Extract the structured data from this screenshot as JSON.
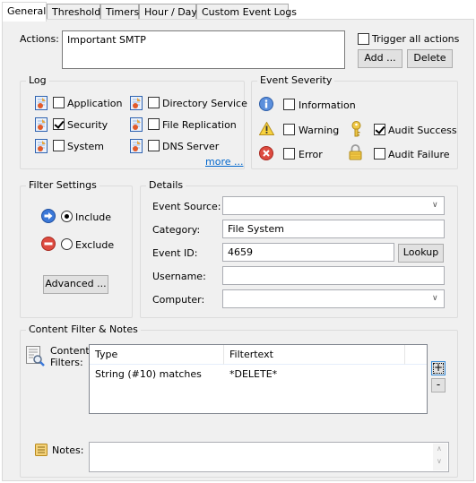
{
  "tabs": [
    {
      "label": "General",
      "active": true
    },
    {
      "label": "Threshold",
      "active": false
    },
    {
      "label": "Timers",
      "active": false
    },
    {
      "label": "Hour / Day",
      "active": false
    },
    {
      "label": "Custom Event Logs",
      "active": false
    }
  ],
  "actions": {
    "label": "Actions:",
    "value": "Important SMTP",
    "trigger_all_label": "Trigger all actions",
    "trigger_all_checked": false,
    "add_label": "Add ...",
    "delete_label": "Delete"
  },
  "log": {
    "title": "Log",
    "items": [
      {
        "label": "Application",
        "checked": false
      },
      {
        "label": "Security",
        "checked": true
      },
      {
        "label": "System",
        "checked": false
      },
      {
        "label": "Directory Service",
        "checked": false
      },
      {
        "label": "File Replication",
        "checked": false
      },
      {
        "label": "DNS Server",
        "checked": false
      }
    ],
    "more_label": "more ..."
  },
  "severity": {
    "title": "Event Severity",
    "items": [
      {
        "label": "Information",
        "checked": false,
        "icon": "info-icon"
      },
      {
        "label": "Warning",
        "checked": false,
        "icon": "warning-icon"
      },
      {
        "label": "Error",
        "checked": false,
        "icon": "error-icon"
      },
      {
        "label": "Audit Success",
        "checked": true,
        "icon": "key-icon"
      },
      {
        "label": "Audit Failure",
        "checked": false,
        "icon": "lock-icon"
      }
    ]
  },
  "filter_settings": {
    "title": "Filter Settings",
    "include_label": "Include",
    "exclude_label": "Exclude",
    "selected": "Include",
    "advanced_label": "Advanced ..."
  },
  "details": {
    "title": "Details",
    "event_source_label": "Event Source:",
    "event_source_value": "",
    "category_label": "Category:",
    "category_value": "File System",
    "event_id_label": "Event ID:",
    "event_id_value": "4659",
    "lookup_label": "Lookup",
    "username_label": "Username:",
    "username_value": "",
    "computer_label": "Computer:",
    "computer_value": ""
  },
  "content": {
    "title": "Content Filter & Notes",
    "filters_label_1": "Content",
    "filters_label_2": "Filters:",
    "columns": [
      "Type",
      "Filtertext"
    ],
    "rows": [
      {
        "type": "String (#10) matches",
        "filtertext": "*DELETE*"
      }
    ],
    "add_symbol": "+",
    "remove_symbol": "-",
    "notes_label": "Notes:",
    "notes_value": ""
  },
  "colors": {
    "panel_bg": "#f0f0f0",
    "link": "#0066cc",
    "info_blue": "#3d7fd6",
    "warning_yellow": "#f5c518",
    "error_red": "#d9453b"
  }
}
